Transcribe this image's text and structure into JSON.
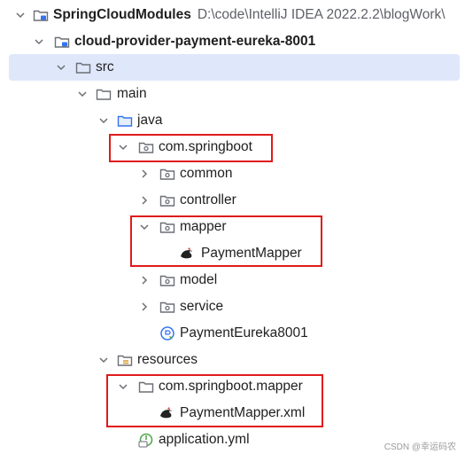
{
  "project_tree": {
    "root": {
      "name": "SpringCloudModules",
      "path": "D:\\code\\IntelliJ IDEA 2022.2.2\\blogWork\\"
    },
    "module": {
      "name": "cloud-provider-payment-eureka-8001"
    },
    "src": "src",
    "main": "main",
    "java": "java",
    "package": "com.springboot",
    "common": "common",
    "controller": "controller",
    "mapper": "mapper",
    "mapper_class": "PaymentMapper",
    "model": "model",
    "service": "service",
    "app_class": "PaymentEureka8001",
    "resources": "resources",
    "res_package": "com.springboot.mapper",
    "mapper_xml": "PaymentMapper.xml",
    "app_yml": "application.yml"
  },
  "watermark": "CSDN @幸运码农",
  "colors": {
    "selection": "#dfe7fa",
    "highlight": "#e01b1b"
  }
}
